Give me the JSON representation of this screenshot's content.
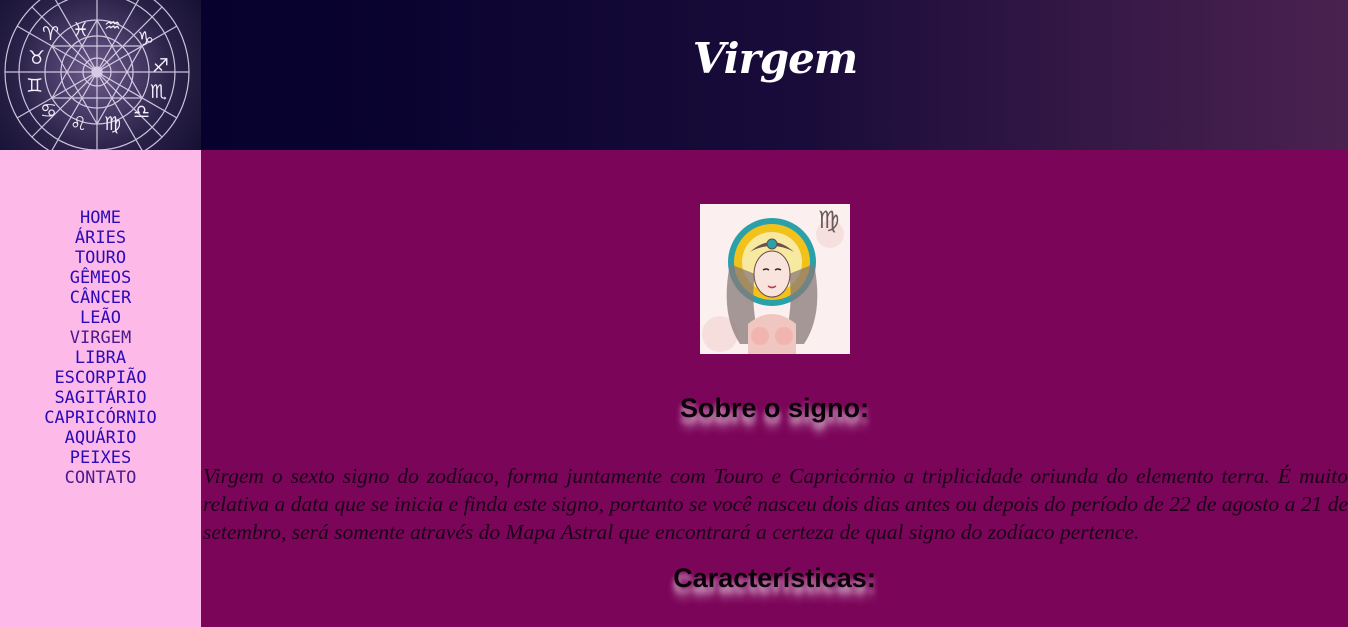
{
  "header": {
    "title": "Virgem"
  },
  "sidebar": {
    "items": [
      {
        "label": "HOME"
      },
      {
        "label": "ÁRIES"
      },
      {
        "label": "TOURO"
      },
      {
        "label": "GÊMEOS"
      },
      {
        "label": "CÂNCER"
      },
      {
        "label": "LEÃO"
      },
      {
        "label": "VIRGEM"
      },
      {
        "label": "LIBRA"
      },
      {
        "label": "ESCORPIÃO"
      },
      {
        "label": "SAGITÁRIO"
      },
      {
        "label": "CAPRICÓRNIO"
      },
      {
        "label": "AQUÁRIO"
      },
      {
        "label": "PEIXES"
      },
      {
        "label": "CONTATO"
      }
    ]
  },
  "main": {
    "section1_heading": "Sobre o signo:",
    "section1_text": "Virgem o sexto signo do zodíaco, forma juntamente com Touro e Capricórnio a triplicidade oriunda do elemento terra. É muito relativa a data que se inicia e finda este signo, portanto se você nasceu dois dias antes ou depois do período de 22 de agosto a 21 de setembro, será somente através do Mapa Astral que encontrará a certeza de qual signo do zodíaco pertence.",
    "section2_heading": "Características:"
  },
  "colors": {
    "main_bg": "#7b0559",
    "sidebar_bg": "#fdb9e8",
    "nav_link": "#2b0bb8",
    "header_dark": "#03002a",
    "header_light": "#4a2250"
  }
}
